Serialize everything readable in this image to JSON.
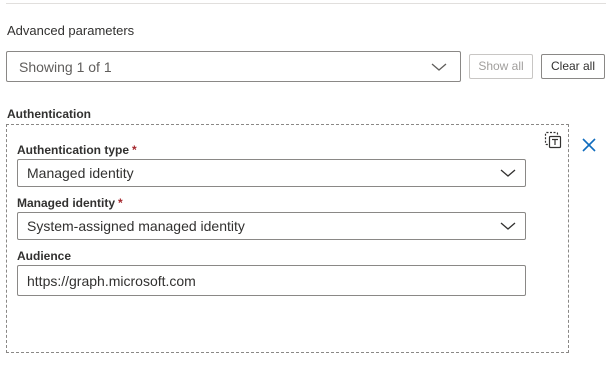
{
  "advanced": {
    "title": "Advanced parameters",
    "showing_value": "Showing 1 of 1",
    "show_all_label": "Show all",
    "clear_all_label": "Clear all"
  },
  "authentication": {
    "heading": "Authentication",
    "fields": {
      "auth_type": {
        "label": "Authentication type",
        "required_mark": "*",
        "value": "Managed identity"
      },
      "managed_identity": {
        "label": "Managed identity",
        "required_mark": "*",
        "value": "System-assigned managed identity"
      },
      "audience": {
        "label": "Audience",
        "value": "https://graph.microsoft.com"
      }
    }
  },
  "icons": {
    "chevron": "chevron-down-icon",
    "copy": "copy-icon",
    "close": "close-icon"
  },
  "colors": {
    "accent": "#0f6cbd",
    "required": "#a4262c",
    "border": "#8a8886",
    "disabled_text": "#a19f9d"
  }
}
